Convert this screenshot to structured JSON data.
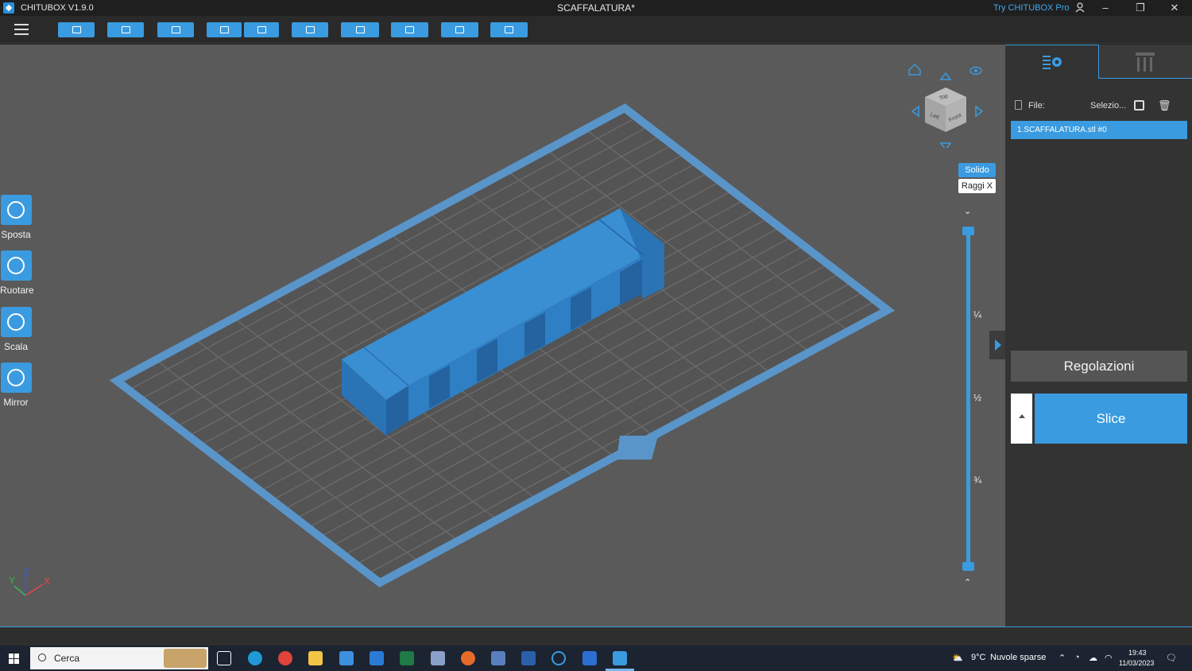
{
  "window": {
    "app_name": "CHITUBOX V1.9.0",
    "document_title": "SCAFFALATURA*",
    "promo_link": "Try CHITUBOX Pro"
  },
  "toolbar": {
    "buttons": [
      "open-file-icon",
      "save-icon",
      "import-icon",
      "undo-icon",
      "redo-icon",
      "copy-icon",
      "layout-icon",
      "hollow-icon",
      "drill-icon",
      "print-settings-icon"
    ]
  },
  "left_tools": {
    "move_label": "Sposta",
    "rotate_label": "Ruotare",
    "scale_label": "Scala",
    "mirror_label": "Mirror"
  },
  "view_cube": {
    "top_face": "Top",
    "left_face": "Left",
    "front_face": "Front"
  },
  "render_mode": {
    "solid_label": "Solido",
    "xray_label": "Raggi X"
  },
  "layer_slider": {
    "q1": "¼",
    "q2": "½",
    "q3": "¾"
  },
  "axes": {
    "x": "X",
    "y": "Y",
    "z": "Z"
  },
  "right_panel": {
    "file_label": "File:",
    "select_label": "Selezio...",
    "files": [
      "1.SCAFFALATURA.stl #0"
    ],
    "adjust_button": "Regolazioni",
    "slice_button": "Slice"
  },
  "taskbar": {
    "search_placeholder": "Cerca",
    "weather_temp": "9°C",
    "weather_text": "Nuvole sparse",
    "time": "19:43",
    "date": "11/03/2023"
  },
  "colors": {
    "accent": "#3a9be0",
    "viewport": "#5a5a5a",
    "model": "#2f7fc5"
  }
}
